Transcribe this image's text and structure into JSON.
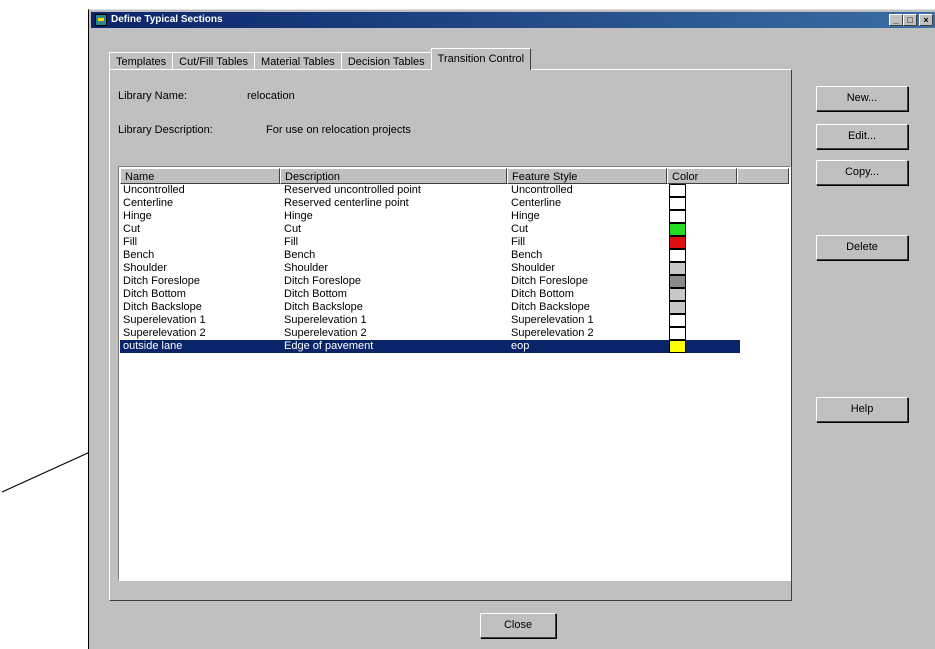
{
  "window": {
    "title": "Define Typical Sections",
    "minimize": "_",
    "maximize": "□",
    "close": "×"
  },
  "tabs": [
    {
      "label": "Templates"
    },
    {
      "label": "Cut/Fill Tables"
    },
    {
      "label": "Material Tables"
    },
    {
      "label": "Decision Tables"
    },
    {
      "label": "Transition Control"
    }
  ],
  "library": {
    "name_label": "Library Name:",
    "name_value": "relocation",
    "desc_label": "Library Description:",
    "desc_value": "For use on relocation projects"
  },
  "list": {
    "columns": [
      "Name",
      "Description",
      "Feature Style",
      "Color"
    ],
    "rows": [
      {
        "name": "Uncontrolled",
        "description": "Reserved uncontrolled point",
        "style": "Uncontrolled",
        "color": "#ffffff"
      },
      {
        "name": "Centerline",
        "description": "Reserved centerline point",
        "style": "Centerline",
        "color": "#ffffff"
      },
      {
        "name": "Hinge",
        "description": "Hinge",
        "style": "Hinge",
        "color": "#ffffff"
      },
      {
        "name": "Cut",
        "description": "Cut",
        "style": "Cut",
        "color": "#22dd22"
      },
      {
        "name": "Fill",
        "description": "Fill",
        "style": "Fill",
        "color": "#e01010"
      },
      {
        "name": "Bench",
        "description": "Bench",
        "style": "Bench",
        "color": "#ffffff"
      },
      {
        "name": "Shoulder",
        "description": "Shoulder",
        "style": "Shoulder",
        "color": "#c8c8c8"
      },
      {
        "name": "Ditch Foreslope",
        "description": "Ditch Foreslope",
        "style": "Ditch Foreslope",
        "color": "#8a8a8a"
      },
      {
        "name": "Ditch Bottom",
        "description": "Ditch Bottom",
        "style": "Ditch Bottom",
        "color": "#c8c8c8"
      },
      {
        "name": "Ditch Backslope",
        "description": "Ditch Backslope",
        "style": "Ditch Backslope",
        "color": "#c8c8c8"
      },
      {
        "name": "Superelevation 1",
        "description": "Superelevation 1",
        "style": "Superelevation 1",
        "color": "#ffffff"
      },
      {
        "name": "Superelevation 2",
        "description": "Superelevation 2",
        "style": "Superelevation 2",
        "color": "#ffffff"
      },
      {
        "name": "outside lane",
        "description": "Edge of pavement",
        "style": "eop",
        "color": "#ffff00",
        "selected": true
      }
    ]
  },
  "buttons": {
    "new": "New...",
    "edit": "Edit...",
    "copy": "Copy...",
    "delete": "Delete",
    "help": "Help",
    "close": "Close"
  },
  "colors": {
    "selection": "#0a246a",
    "face": "#c0c0c0",
    "titlebar": "#0a246a"
  }
}
